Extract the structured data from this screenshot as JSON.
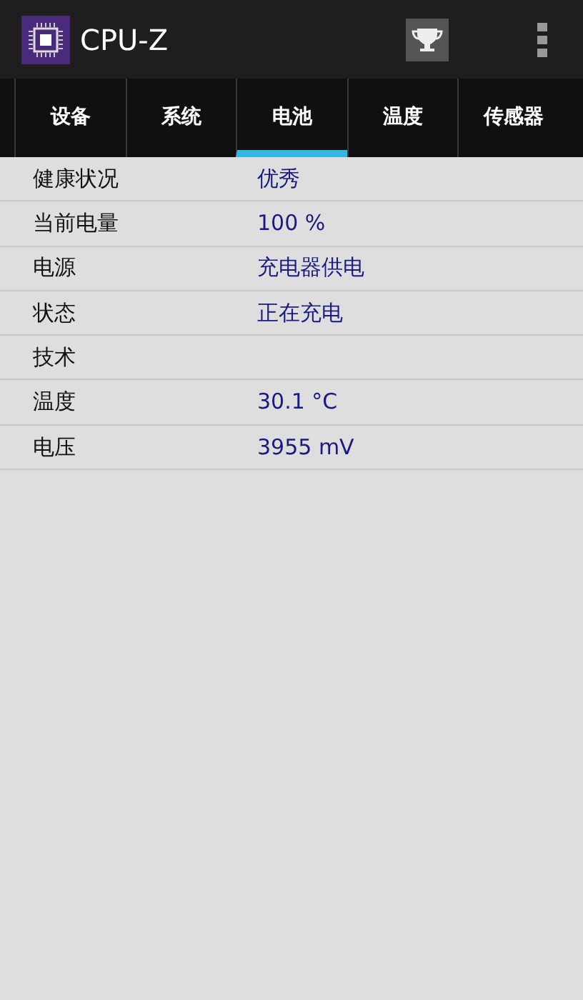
{
  "app_bar": {
    "title": "CPU-Z"
  },
  "tabs": [
    {
      "label": "设备",
      "selected": false
    },
    {
      "label": "系统",
      "selected": false
    },
    {
      "label": "电池",
      "selected": true
    },
    {
      "label": "温度",
      "selected": false
    },
    {
      "label": "传感器",
      "selected": false
    }
  ],
  "rows": [
    {
      "label": "健康状况",
      "value": "优秀"
    },
    {
      "label": "当前电量",
      "value": "100 %"
    },
    {
      "label": "电源",
      "value": "充电器供电"
    },
    {
      "label": "状态",
      "value": "正在充电"
    },
    {
      "label": "技术"
    },
    {
      "label": "温度",
      "value": "30.1 °C"
    },
    {
      "label": "电压",
      "value": "3955 mV"
    }
  ]
}
